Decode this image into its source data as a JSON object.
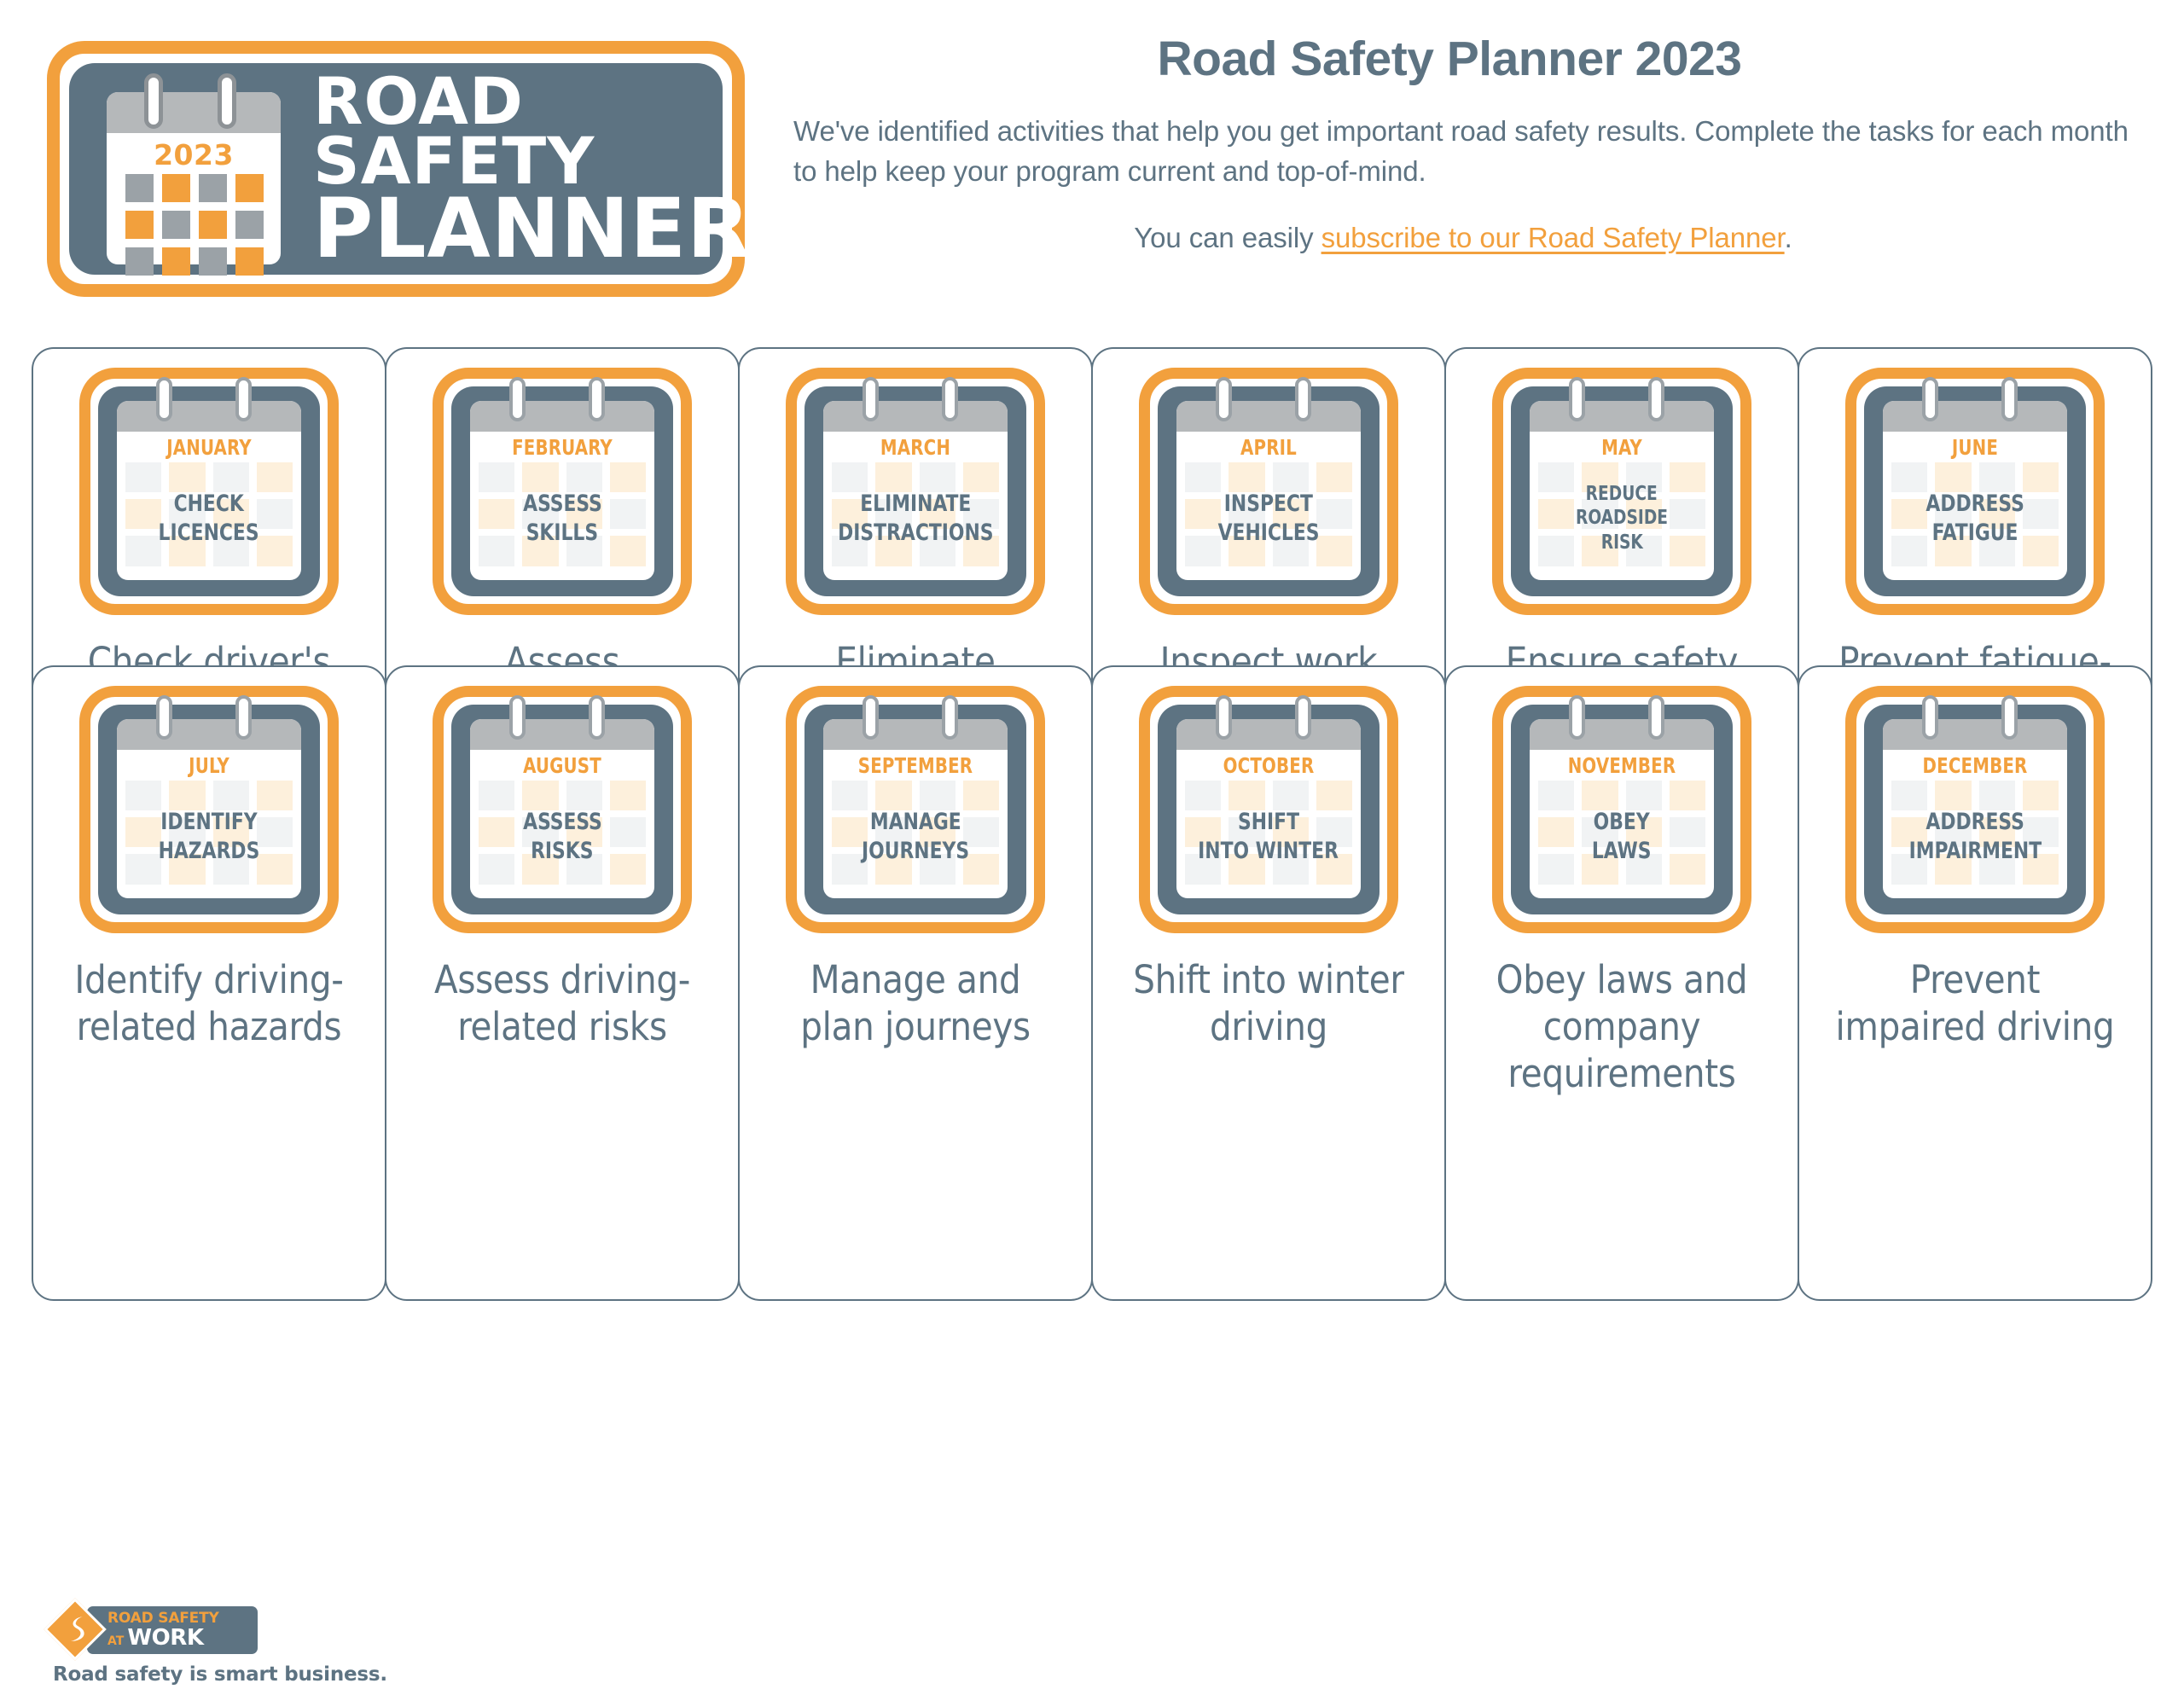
{
  "colors": {
    "orange": "#F2A03D",
    "slate": "#5D7382",
    "gray": "#B5B8BA",
    "checker_gray": "#F1F3F4",
    "checker_cream": "#FDF0DC",
    "white": "#FFFFFF"
  },
  "brand": {
    "year": "2023",
    "line1": "ROAD SAFETY",
    "line2": "PLANNER"
  },
  "header": {
    "title": "Road Safety Planner 2023",
    "subtitle": "We've identified activities that help you get important road safety results. Complete the tasks for each month to help keep your program current and top-of-mind.",
    "cta_prefix": "You can easily ",
    "cta_link": "subscribe to our Road Safety Planner",
    "cta_suffix": "."
  },
  "months": [
    {
      "month": "JANUARY",
      "task_lines": [
        "CHECK",
        "LICENCES"
      ],
      "caption": "Check driver's licence and abstract"
    },
    {
      "month": "FEBRUARY",
      "task_lines": [
        "ASSESS",
        "SKILLS"
      ],
      "caption": "Assess employee driving skills"
    },
    {
      "month": "MARCH",
      "task_lines": [
        "ELIMINATE",
        "DISTRACTIONS"
      ],
      "caption": "Eliminate driving distractions"
    },
    {
      "month": "APRIL",
      "task_lines": [
        "INSPECT",
        "VEHICLES"
      ],
      "caption": "Inspect work vehicles regularly"
    },
    {
      "month": "MAY",
      "task_lines": [
        "REDUCE",
        "ROADSIDE",
        "RISK"
      ],
      "caption": "Ensure safety for roadside workers"
    },
    {
      "month": "JUNE",
      "task_lines": [
        "ADDRESS",
        "FATIGUE"
      ],
      "caption": "Prevent fatigue-related crashes"
    },
    {
      "month": "JULY",
      "task_lines": [
        "IDENTIFY",
        "HAZARDS"
      ],
      "caption": "Identify driving-related hazards"
    },
    {
      "month": "AUGUST",
      "task_lines": [
        "ASSESS",
        "RISKS"
      ],
      "caption": "Assess driving-related risks"
    },
    {
      "month": "SEPTEMBER",
      "task_lines": [
        "MANAGE",
        "JOURNEYS"
      ],
      "caption": "Manage and plan journeys"
    },
    {
      "month": "OCTOBER",
      "task_lines": [
        "SHIFT",
        "INTO WINTER"
      ],
      "caption": "Shift into winter driving"
    },
    {
      "month": "NOVEMBER",
      "task_lines": [
        "OBEY",
        "LAWS"
      ],
      "caption": "Obey laws and company requirements"
    },
    {
      "month": "DECEMBER",
      "task_lines": [
        "ADDRESS",
        "IMPAIRMENT"
      ],
      "caption": "Prevent impaired driving"
    }
  ],
  "footer": {
    "logo_line1": "ROAD SAFETY",
    "logo_at": "AT",
    "logo_work": "WORK",
    "tagline": "Road safety is smart business."
  }
}
